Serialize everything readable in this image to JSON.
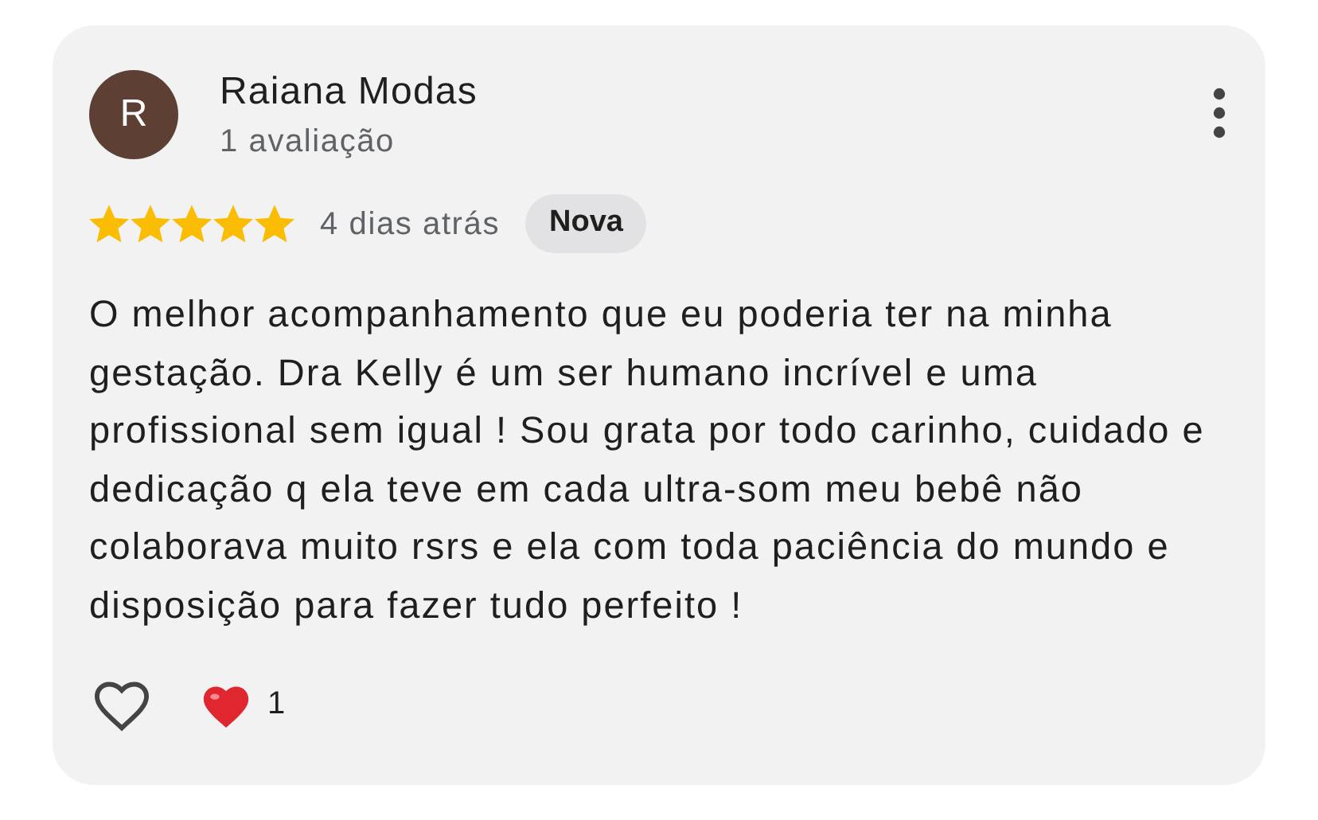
{
  "review": {
    "avatar_letter": "R",
    "author": "Raiana Modas",
    "review_count": "1 avaliação",
    "stars": 5,
    "time": "4 dias atrás",
    "badge": "Nova",
    "text": "O melhor acompanhamento que eu poderia ter na minha gestação. Dra Kelly é um ser humano incrível e uma profissional sem igual ! Sou grata por todo carinho, cuidado e dedicação q ela teve em cada ultra-som meu bebê não colaborava muito rsrs e ela com toda paciência do mundo e disposição para fazer tudo perfeito !",
    "liked": false,
    "reaction_count": "1"
  }
}
